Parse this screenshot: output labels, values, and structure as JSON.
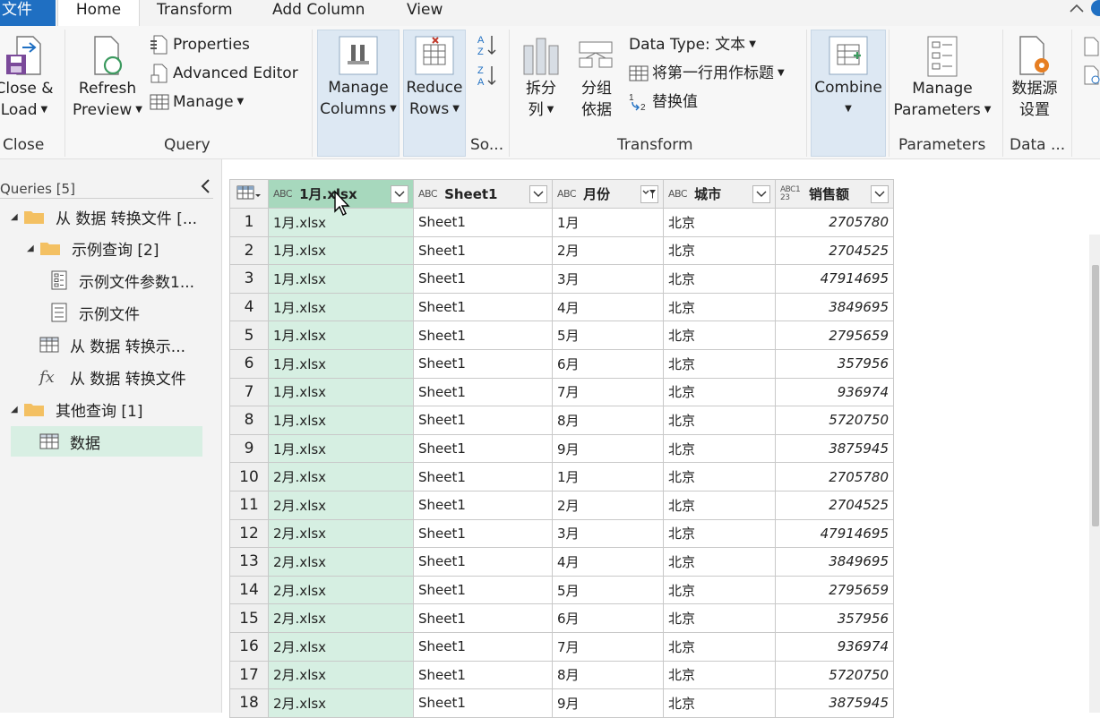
{
  "tabs": {
    "file": "文件",
    "home": "Home",
    "transform": "Transform",
    "add_column": "Add Column",
    "view": "View"
  },
  "ribbon": {
    "close_load": [
      "Close &",
      "Load"
    ],
    "refresh_preview": [
      "Refresh",
      "Preview"
    ],
    "properties": "Properties",
    "advanced_editor": "Advanced Editor",
    "manage": "Manage",
    "manage_columns": [
      "Manage",
      "Columns"
    ],
    "reduce_rows": [
      "Reduce",
      "Rows"
    ],
    "split_column": [
      "拆分",
      "列"
    ],
    "group_by": [
      "分组",
      "依据"
    ],
    "data_type": "Data Type: 文本",
    "use_first_row": "将第一行用作标题",
    "replace_values": "替换值",
    "combine": "Combine",
    "manage_parameters": [
      "Manage",
      "Parameters"
    ],
    "data_source_settings": [
      "数据源",
      "设置"
    ],
    "group_labels": {
      "close": "Close",
      "query": "Query",
      "sort": "So...",
      "transform": "Transform",
      "parameters": "Parameters",
      "data": "Data ..."
    }
  },
  "queries": {
    "header": "Queries [5]",
    "items": [
      "从 数据 转换文件 [...",
      "示例查询 [2]",
      "示例文件参数1...",
      "示例文件",
      "从 数据 转换示...",
      "从 数据 转换文件",
      "其他查询 [1]",
      "数据"
    ]
  },
  "grid": {
    "columns": [
      {
        "type": "ABC",
        "name": "1月.xlsx"
      },
      {
        "type": "ABC",
        "name": "Sheet1"
      },
      {
        "type": "ABC",
        "name": "月份"
      },
      {
        "type": "ABC",
        "name": "城市"
      },
      {
        "type": "ABC123",
        "name": "销售额"
      }
    ],
    "rows": [
      [
        "1",
        "1月.xlsx",
        "Sheet1",
        "1月",
        "北京",
        "2705780"
      ],
      [
        "2",
        "1月.xlsx",
        "Sheet1",
        "2月",
        "北京",
        "2704525"
      ],
      [
        "3",
        "1月.xlsx",
        "Sheet1",
        "3月",
        "北京",
        "47914695"
      ],
      [
        "4",
        "1月.xlsx",
        "Sheet1",
        "4月",
        "北京",
        "3849695"
      ],
      [
        "5",
        "1月.xlsx",
        "Sheet1",
        "5月",
        "北京",
        "2795659"
      ],
      [
        "6",
        "1月.xlsx",
        "Sheet1",
        "6月",
        "北京",
        "357956"
      ],
      [
        "7",
        "1月.xlsx",
        "Sheet1",
        "7月",
        "北京",
        "936974"
      ],
      [
        "8",
        "1月.xlsx",
        "Sheet1",
        "8月",
        "北京",
        "5720750"
      ],
      [
        "9",
        "1月.xlsx",
        "Sheet1",
        "9月",
        "北京",
        "3875945"
      ],
      [
        "10",
        "2月.xlsx",
        "Sheet1",
        "1月",
        "北京",
        "2705780"
      ],
      [
        "11",
        "2月.xlsx",
        "Sheet1",
        "2月",
        "北京",
        "2704525"
      ],
      [
        "12",
        "2月.xlsx",
        "Sheet1",
        "3月",
        "北京",
        "47914695"
      ],
      [
        "13",
        "2月.xlsx",
        "Sheet1",
        "4月",
        "北京",
        "3849695"
      ],
      [
        "14",
        "2月.xlsx",
        "Sheet1",
        "5月",
        "北京",
        "2795659"
      ],
      [
        "15",
        "2月.xlsx",
        "Sheet1",
        "6月",
        "北京",
        "357956"
      ],
      [
        "16",
        "2月.xlsx",
        "Sheet1",
        "7月",
        "北京",
        "936974"
      ],
      [
        "17",
        "2月.xlsx",
        "Sheet1",
        "8月",
        "北京",
        "5720750"
      ],
      [
        "18",
        "2月.xlsx",
        "Sheet1",
        "9月",
        "北京",
        "3875945"
      ]
    ]
  },
  "colors": {
    "accent": "#1f6fc2",
    "selected_column": "#d6efe2",
    "selected_header": "#a7d8bd",
    "highlight_button": "#dde8f3"
  }
}
